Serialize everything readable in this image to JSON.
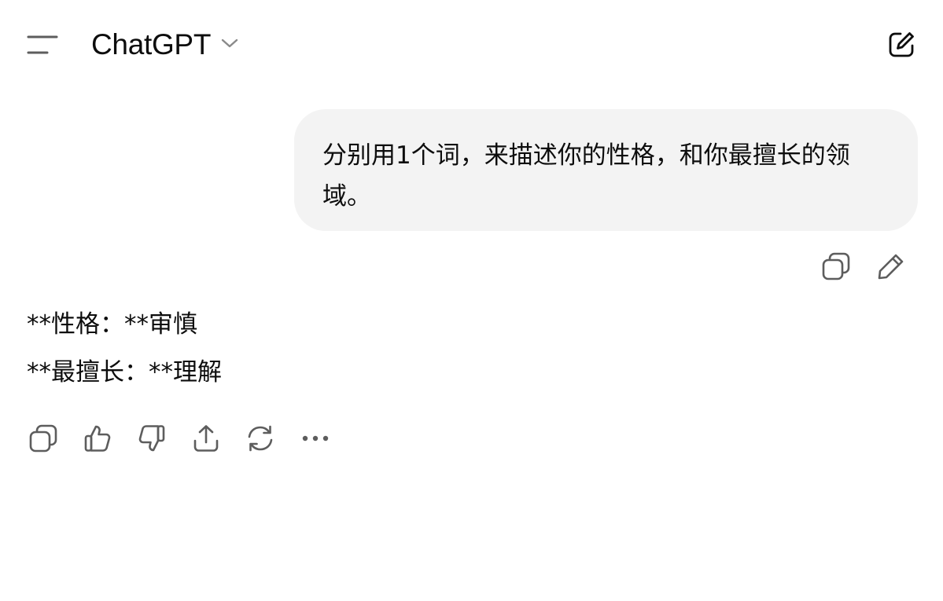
{
  "header": {
    "menu_icon": "menu-icon",
    "model_name": "ChatGPT",
    "model_chevron_icon": "chevron-down-icon",
    "new_chat_icon": "new-chat-icon"
  },
  "conversation": {
    "user_message": {
      "text": "分别用1个词，来描述你的性格，和你最擅长的领域。",
      "actions": [
        "copy-icon",
        "edit-icon"
      ]
    },
    "assistant_message": {
      "lines": [
        "**性格：**审慎",
        "**最擅长：**理解"
      ],
      "actions": [
        "copy-icon",
        "thumbs-up-icon",
        "thumbs-down-icon",
        "share-icon",
        "regenerate-icon",
        "more-icon"
      ]
    }
  },
  "colors": {
    "text": "#0d0d0d",
    "icon": "#5d5d5d",
    "user_bubble_bg": "#f3f3f3",
    "background": "#ffffff"
  }
}
